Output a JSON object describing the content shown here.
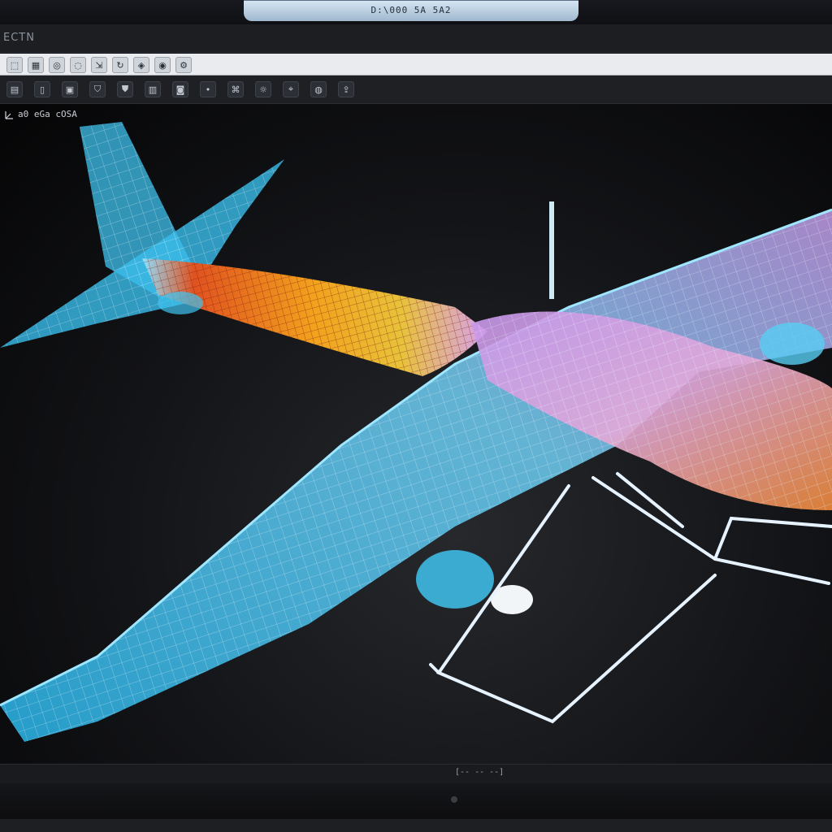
{
  "header": {
    "tab_label": "D:\\000 5A 5A2"
  },
  "app": {
    "title": "ECTN"
  },
  "toolbar1": {
    "buttons": [
      {
        "icon": "select-icon",
        "glyph": "⬚"
      },
      {
        "icon": "grid-icon",
        "glyph": "▦"
      },
      {
        "icon": "globe-icon",
        "glyph": "◎"
      },
      {
        "icon": "orbit-icon",
        "glyph": "◌"
      },
      {
        "icon": "scale-icon",
        "glyph": "⇲"
      },
      {
        "icon": "rotate-icon",
        "glyph": "↻"
      },
      {
        "icon": "render-icon",
        "glyph": "◈"
      },
      {
        "icon": "view-icon",
        "glyph": "◉"
      },
      {
        "icon": "settings-icon",
        "glyph": "⚙"
      }
    ]
  },
  "toolbar2": {
    "buttons": [
      {
        "icon": "new-icon",
        "glyph": "▤"
      },
      {
        "icon": "page-icon",
        "glyph": "▯"
      },
      {
        "icon": "save-icon",
        "glyph": "▣"
      },
      {
        "icon": "shield-icon",
        "glyph": "⛉"
      },
      {
        "icon": "shield-alt-icon",
        "glyph": "⛊"
      },
      {
        "icon": "layers-icon",
        "glyph": "▥"
      },
      {
        "icon": "camera-icon",
        "glyph": "◙"
      },
      {
        "icon": "dot-icon",
        "glyph": "•"
      },
      {
        "icon": "mesh-icon",
        "glyph": "⌘"
      },
      {
        "icon": "light-icon",
        "glyph": "☼"
      },
      {
        "icon": "probe-icon",
        "glyph": "⌖"
      },
      {
        "icon": "material-icon",
        "glyph": "◍"
      },
      {
        "icon": "export-icon",
        "glyph": "⇪"
      }
    ]
  },
  "viewport": {
    "label": "a0 eGa cOSA"
  },
  "status": {
    "text": "[-- -- --]"
  },
  "colors": {
    "wing": "#3fc3ef",
    "fuselage_hot": "#e0521f",
    "fuselage_mid": "#f2a21d",
    "canopy": "#c98be8",
    "wire": "#e6f3ff"
  }
}
